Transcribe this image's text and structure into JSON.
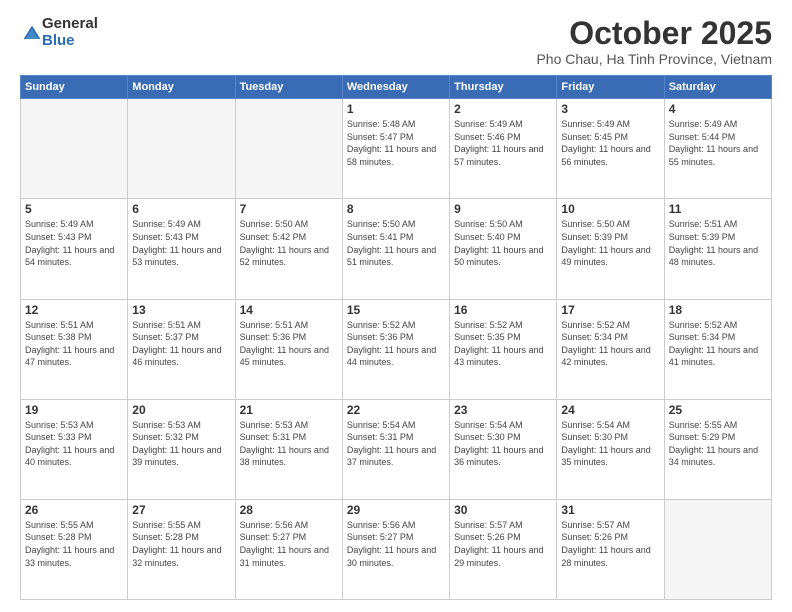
{
  "header": {
    "logo_general": "General",
    "logo_blue": "Blue",
    "month_title": "October 2025",
    "subtitle": "Pho Chau, Ha Tinh Province, Vietnam"
  },
  "days_of_week": [
    "Sunday",
    "Monday",
    "Tuesday",
    "Wednesday",
    "Thursday",
    "Friday",
    "Saturday"
  ],
  "weeks": [
    [
      {
        "day": "",
        "empty": true
      },
      {
        "day": "",
        "empty": true
      },
      {
        "day": "",
        "empty": true
      },
      {
        "day": "1",
        "sunrise": "Sunrise: 5:48 AM",
        "sunset": "Sunset: 5:47 PM",
        "daylight": "Daylight: 11 hours and 58 minutes."
      },
      {
        "day": "2",
        "sunrise": "Sunrise: 5:49 AM",
        "sunset": "Sunset: 5:46 PM",
        "daylight": "Daylight: 11 hours and 57 minutes."
      },
      {
        "day": "3",
        "sunrise": "Sunrise: 5:49 AM",
        "sunset": "Sunset: 5:45 PM",
        "daylight": "Daylight: 11 hours and 56 minutes."
      },
      {
        "day": "4",
        "sunrise": "Sunrise: 5:49 AM",
        "sunset": "Sunset: 5:44 PM",
        "daylight": "Daylight: 11 hours and 55 minutes."
      }
    ],
    [
      {
        "day": "5",
        "sunrise": "Sunrise: 5:49 AM",
        "sunset": "Sunset: 5:43 PM",
        "daylight": "Daylight: 11 hours and 54 minutes."
      },
      {
        "day": "6",
        "sunrise": "Sunrise: 5:49 AM",
        "sunset": "Sunset: 5:43 PM",
        "daylight": "Daylight: 11 hours and 53 minutes."
      },
      {
        "day": "7",
        "sunrise": "Sunrise: 5:50 AM",
        "sunset": "Sunset: 5:42 PM",
        "daylight": "Daylight: 11 hours and 52 minutes."
      },
      {
        "day": "8",
        "sunrise": "Sunrise: 5:50 AM",
        "sunset": "Sunset: 5:41 PM",
        "daylight": "Daylight: 11 hours and 51 minutes."
      },
      {
        "day": "9",
        "sunrise": "Sunrise: 5:50 AM",
        "sunset": "Sunset: 5:40 PM",
        "daylight": "Daylight: 11 hours and 50 minutes."
      },
      {
        "day": "10",
        "sunrise": "Sunrise: 5:50 AM",
        "sunset": "Sunset: 5:39 PM",
        "daylight": "Daylight: 11 hours and 49 minutes."
      },
      {
        "day": "11",
        "sunrise": "Sunrise: 5:51 AM",
        "sunset": "Sunset: 5:39 PM",
        "daylight": "Daylight: 11 hours and 48 minutes."
      }
    ],
    [
      {
        "day": "12",
        "sunrise": "Sunrise: 5:51 AM",
        "sunset": "Sunset: 5:38 PM",
        "daylight": "Daylight: 11 hours and 47 minutes."
      },
      {
        "day": "13",
        "sunrise": "Sunrise: 5:51 AM",
        "sunset": "Sunset: 5:37 PM",
        "daylight": "Daylight: 11 hours and 46 minutes."
      },
      {
        "day": "14",
        "sunrise": "Sunrise: 5:51 AM",
        "sunset": "Sunset: 5:36 PM",
        "daylight": "Daylight: 11 hours and 45 minutes."
      },
      {
        "day": "15",
        "sunrise": "Sunrise: 5:52 AM",
        "sunset": "Sunset: 5:36 PM",
        "daylight": "Daylight: 11 hours and 44 minutes."
      },
      {
        "day": "16",
        "sunrise": "Sunrise: 5:52 AM",
        "sunset": "Sunset: 5:35 PM",
        "daylight": "Daylight: 11 hours and 43 minutes."
      },
      {
        "day": "17",
        "sunrise": "Sunrise: 5:52 AM",
        "sunset": "Sunset: 5:34 PM",
        "daylight": "Daylight: 11 hours and 42 minutes."
      },
      {
        "day": "18",
        "sunrise": "Sunrise: 5:52 AM",
        "sunset": "Sunset: 5:34 PM",
        "daylight": "Daylight: 11 hours and 41 minutes."
      }
    ],
    [
      {
        "day": "19",
        "sunrise": "Sunrise: 5:53 AM",
        "sunset": "Sunset: 5:33 PM",
        "daylight": "Daylight: 11 hours and 40 minutes."
      },
      {
        "day": "20",
        "sunrise": "Sunrise: 5:53 AM",
        "sunset": "Sunset: 5:32 PM",
        "daylight": "Daylight: 11 hours and 39 minutes."
      },
      {
        "day": "21",
        "sunrise": "Sunrise: 5:53 AM",
        "sunset": "Sunset: 5:31 PM",
        "daylight": "Daylight: 11 hours and 38 minutes."
      },
      {
        "day": "22",
        "sunrise": "Sunrise: 5:54 AM",
        "sunset": "Sunset: 5:31 PM",
        "daylight": "Daylight: 11 hours and 37 minutes."
      },
      {
        "day": "23",
        "sunrise": "Sunrise: 5:54 AM",
        "sunset": "Sunset: 5:30 PM",
        "daylight": "Daylight: 11 hours and 36 minutes."
      },
      {
        "day": "24",
        "sunrise": "Sunrise: 5:54 AM",
        "sunset": "Sunset: 5:30 PM",
        "daylight": "Daylight: 11 hours and 35 minutes."
      },
      {
        "day": "25",
        "sunrise": "Sunrise: 5:55 AM",
        "sunset": "Sunset: 5:29 PM",
        "daylight": "Daylight: 11 hours and 34 minutes."
      }
    ],
    [
      {
        "day": "26",
        "sunrise": "Sunrise: 5:55 AM",
        "sunset": "Sunset: 5:28 PM",
        "daylight": "Daylight: 11 hours and 33 minutes."
      },
      {
        "day": "27",
        "sunrise": "Sunrise: 5:55 AM",
        "sunset": "Sunset: 5:28 PM",
        "daylight": "Daylight: 11 hours and 32 minutes."
      },
      {
        "day": "28",
        "sunrise": "Sunrise: 5:56 AM",
        "sunset": "Sunset: 5:27 PM",
        "daylight": "Daylight: 11 hours and 31 minutes."
      },
      {
        "day": "29",
        "sunrise": "Sunrise: 5:56 AM",
        "sunset": "Sunset: 5:27 PM",
        "daylight": "Daylight: 11 hours and 30 minutes."
      },
      {
        "day": "30",
        "sunrise": "Sunrise: 5:57 AM",
        "sunset": "Sunset: 5:26 PM",
        "daylight": "Daylight: 11 hours and 29 minutes."
      },
      {
        "day": "31",
        "sunrise": "Sunrise: 5:57 AM",
        "sunset": "Sunset: 5:26 PM",
        "daylight": "Daylight: 11 hours and 28 minutes."
      },
      {
        "day": "",
        "empty": true
      }
    ]
  ]
}
